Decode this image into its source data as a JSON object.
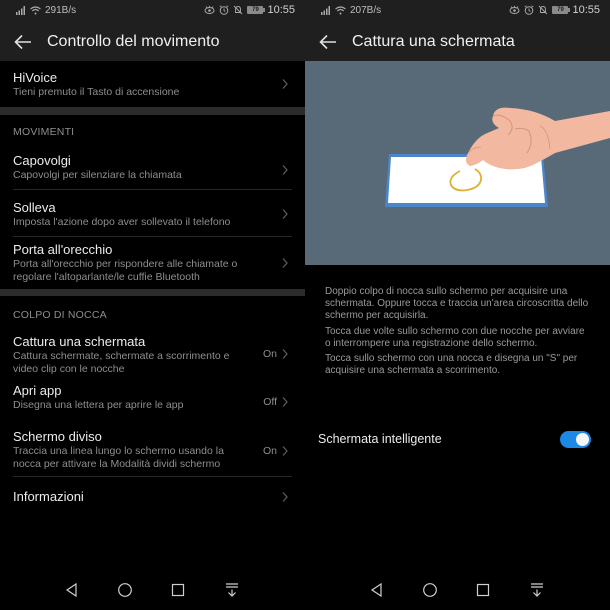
{
  "left": {
    "status": {
      "speed": "291B/s",
      "battery": "79",
      "time": "10:55"
    },
    "title": "Controllo del movimento",
    "top_item": {
      "title": "HiVoice",
      "subtitle": "Tieni premuto il Tasto di accensione"
    },
    "sections": [
      {
        "header": "MOVIMENTI",
        "items": [
          {
            "title": "Capovolgi",
            "subtitle": "Capovolgi per silenziare la chiamata",
            "state": ""
          },
          {
            "title": "Solleva",
            "subtitle": "Imposta l'azione dopo aver sollevato il telefono",
            "state": ""
          },
          {
            "title": "Porta all'orecchio",
            "subtitle": "Porta all'orecchio per rispondere alle chiamate o regolare l'altoparlante/le cuffie Bluetooth",
            "state": ""
          }
        ]
      },
      {
        "header": "COLPO DI NOCCA",
        "items": [
          {
            "title": "Cattura una schermata",
            "subtitle": "Cattura schermate, schermate a scorrimento e video clip con le nocche",
            "state": "On"
          },
          {
            "title": "Apri app",
            "subtitle": "Disegna una lettera per aprire le app",
            "state": "Off"
          },
          {
            "title": "Schermo diviso",
            "subtitle": "Traccia una linea lungo lo schermo usando la nocca per attivare la Modalità dividi schermo",
            "state": "On"
          },
          {
            "title": "Informazioni",
            "subtitle": "",
            "state": ""
          }
        ]
      }
    ]
  },
  "right": {
    "status": {
      "speed": "207B/s",
      "battery": "79",
      "time": "10:55"
    },
    "title": "Cattura una schermata",
    "illustration": {
      "background": "#586a78",
      "phone_border": "#4a86c8",
      "circle_color": "#e0b030",
      "hand_color": "#f2b8a0"
    },
    "description": [
      "Doppio colpo di nocca sullo schermo per acquisire una schermata. Oppure tocca e traccia un'area circoscritta dello schermo per acquisirla.",
      "Tocca due volte sullo schermo con due nocche per avviare o interrompere una registrazione dello schermo.",
      "Tocca sullo schermo con una nocca e disegna un \"S\" per acquisire una schermata a scorrimento."
    ],
    "toggle": {
      "label": "Schermata intelligente",
      "on": true,
      "color": "#1e88e5"
    }
  },
  "nav": {
    "icons": [
      "back-icon",
      "home-icon",
      "recents-icon",
      "notification-pull-icon"
    ]
  }
}
